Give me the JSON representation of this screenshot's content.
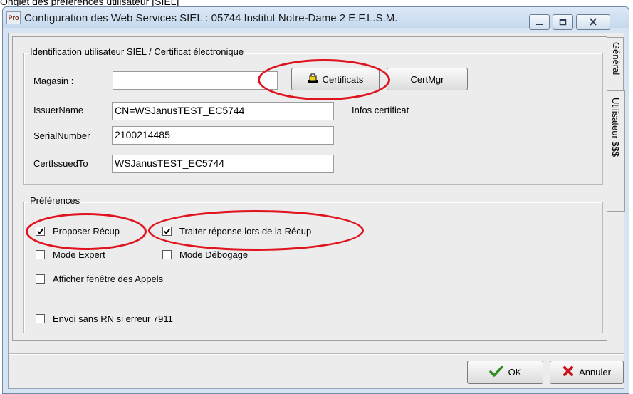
{
  "caption": "Onglet des préférences utilisateur [SIEL]",
  "window": {
    "icon": "app-icon",
    "title": "Configuration des Web Services SIEL : 05744 Institut Notre-Dame 2 E.F.L.S.M.",
    "controls": [
      "minimize-icon",
      "maximize-icon",
      "close-icon"
    ]
  },
  "tabs": [
    {
      "label": "Général",
      "active": false
    },
    {
      "label": "Utilisateur $$$",
      "active": true
    }
  ],
  "identification": {
    "legend": "Identification utilisateur SIEL / Certificat électronique",
    "magasin_label": "Magasin :",
    "magasin_value": "",
    "certificats_button": "Certificats",
    "certificats_icon": "certificate-icon",
    "certmgr_button": "CertMgr",
    "issuer_label": "IssuerName",
    "issuer_value": "CN=WSJanusTEST_EC5744",
    "infos_label": "Infos certificat",
    "serial_label": "SerialNumber",
    "serial_value": "2100214485",
    "issuedto_label": "CertIssuedTo",
    "issuedto_value": "WSJanusTEST_EC5744"
  },
  "preferences": {
    "legend": "Préférences",
    "options": [
      {
        "label": "Proposer Récup",
        "checked": true
      },
      {
        "label": "Traiter réponse lors de la Récup",
        "checked": true
      },
      {
        "label": "Mode Expert",
        "checked": false
      },
      {
        "label": "Mode Débogage",
        "checked": false
      },
      {
        "label": "Afficher fenêtre des Appels",
        "checked": false
      },
      {
        "label": "Envoi sans RN si erreur 7911",
        "checked": false
      }
    ]
  },
  "footer": {
    "ok_label": "OK",
    "ok_icon": "checkmark-icon",
    "cancel_label": "Annuler",
    "cancel_icon": "cross-icon"
  },
  "colors": {
    "highlight_oval": "#e0141e",
    "ok_check": "#2e8b1e",
    "cancel_cross": "#c8141b"
  }
}
